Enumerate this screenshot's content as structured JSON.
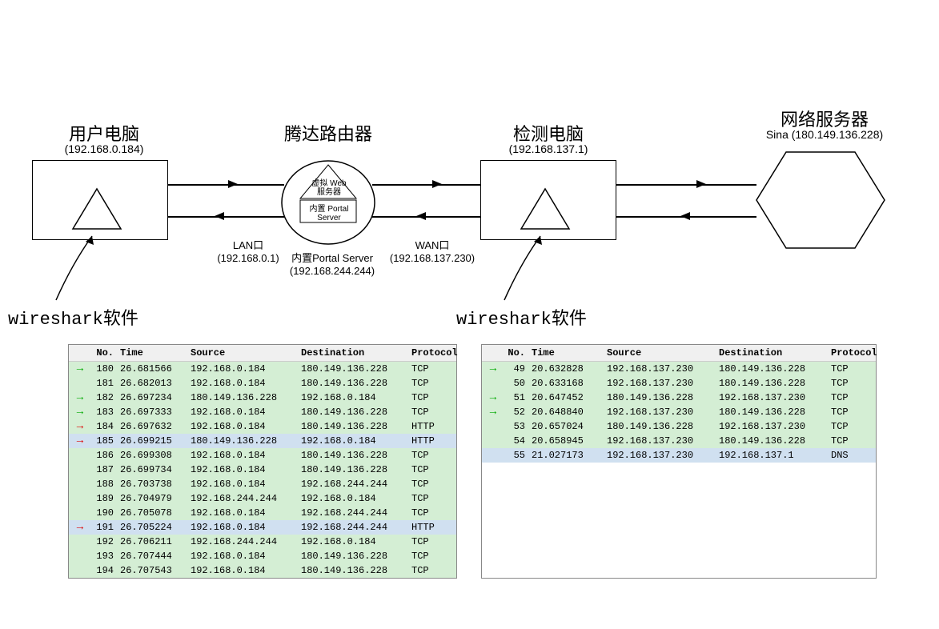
{
  "diagram": {
    "nodes": {
      "user_pc": {
        "title": "用户电脑",
        "ip": "(192.168.0.184)"
      },
      "router": {
        "title": "腾达路由器",
        "virtual_web": "虚拟\nWeb服务器",
        "portal_inner": "内置\nPortal Server",
        "lan_label": "LAN口",
        "lan_ip": "(192.168.0.1)",
        "portal_label": "内置Portal Server",
        "portal_ip": "(192.168.244.244)",
        "wan_label": "WAN口",
        "wan_ip": "(192.168.137.230)"
      },
      "detect_pc": {
        "title": "检测电脑",
        "ip": "(192.168.137.1)"
      },
      "server": {
        "title": "网络服务器",
        "sub": "Sina (180.149.136.228)"
      }
    },
    "wireshark_left": "wireshark软件",
    "wireshark_right": "wireshark软件"
  },
  "tables": {
    "headers": {
      "no": "No.",
      "time": "Time",
      "source": "Source",
      "destination": "Destination",
      "protocol": "Protocol"
    },
    "left": [
      {
        "mark": "green",
        "no": "180",
        "time": "26.681566",
        "src": "192.168.0.184",
        "dst": "180.149.136.228",
        "proto": "TCP",
        "cls": "green"
      },
      {
        "mark": "",
        "no": "181",
        "time": "26.682013",
        "src": "192.168.0.184",
        "dst": "180.149.136.228",
        "proto": "TCP",
        "cls": "green"
      },
      {
        "mark": "green",
        "no": "182",
        "time": "26.697234",
        "src": "180.149.136.228",
        "dst": "192.168.0.184",
        "proto": "TCP",
        "cls": "green"
      },
      {
        "mark": "green",
        "no": "183",
        "time": "26.697333",
        "src": "192.168.0.184",
        "dst": "180.149.136.228",
        "proto": "TCP",
        "cls": "green"
      },
      {
        "mark": "red",
        "no": "184",
        "time": "26.697632",
        "src": "192.168.0.184",
        "dst": "180.149.136.228",
        "proto": "HTTP",
        "cls": "green"
      },
      {
        "mark": "red",
        "no": "185",
        "time": "26.699215",
        "src": "180.149.136.228",
        "dst": "192.168.0.184",
        "proto": "HTTP",
        "cls": "blue"
      },
      {
        "mark": "",
        "no": "186",
        "time": "26.699308",
        "src": "192.168.0.184",
        "dst": "180.149.136.228",
        "proto": "TCP",
        "cls": "green"
      },
      {
        "mark": "",
        "no": "187",
        "time": "26.699734",
        "src": "192.168.0.184",
        "dst": "180.149.136.228",
        "proto": "TCP",
        "cls": "green"
      },
      {
        "mark": "",
        "no": "188",
        "time": "26.703738",
        "src": "192.168.0.184",
        "dst": "192.168.244.244",
        "proto": "TCP",
        "cls": "green"
      },
      {
        "mark": "",
        "no": "189",
        "time": "26.704979",
        "src": "192.168.244.244",
        "dst": "192.168.0.184",
        "proto": "TCP",
        "cls": "green"
      },
      {
        "mark": "",
        "no": "190",
        "time": "26.705078",
        "src": "192.168.0.184",
        "dst": "192.168.244.244",
        "proto": "TCP",
        "cls": "green"
      },
      {
        "mark": "red",
        "no": "191",
        "time": "26.705224",
        "src": "192.168.0.184",
        "dst": "192.168.244.244",
        "proto": "HTTP",
        "cls": "blue"
      },
      {
        "mark": "",
        "no": "192",
        "time": "26.706211",
        "src": "192.168.244.244",
        "dst": "192.168.0.184",
        "proto": "TCP",
        "cls": "green"
      },
      {
        "mark": "",
        "no": "193",
        "time": "26.707444",
        "src": "192.168.0.184",
        "dst": "180.149.136.228",
        "proto": "TCP",
        "cls": "green"
      },
      {
        "mark": "",
        "no": "194",
        "time": "26.707543",
        "src": "192.168.0.184",
        "dst": "180.149.136.228",
        "proto": "TCP",
        "cls": "green"
      }
    ],
    "right": [
      {
        "mark": "green",
        "no": "49",
        "time": "20.632828",
        "src": "192.168.137.230",
        "dst": "180.149.136.228",
        "proto": "TCP",
        "cls": "green"
      },
      {
        "mark": "",
        "no": "50",
        "time": "20.633168",
        "src": "192.168.137.230",
        "dst": "180.149.136.228",
        "proto": "TCP",
        "cls": "green"
      },
      {
        "mark": "green",
        "no": "51",
        "time": "20.647452",
        "src": "180.149.136.228",
        "dst": "192.168.137.230",
        "proto": "TCP",
        "cls": "green"
      },
      {
        "mark": "green",
        "no": "52",
        "time": "20.648840",
        "src": "192.168.137.230",
        "dst": "180.149.136.228",
        "proto": "TCP",
        "cls": "green"
      },
      {
        "mark": "",
        "no": "53",
        "time": "20.657024",
        "src": "180.149.136.228",
        "dst": "192.168.137.230",
        "proto": "TCP",
        "cls": "green"
      },
      {
        "mark": "",
        "no": "54",
        "time": "20.658945",
        "src": "192.168.137.230",
        "dst": "180.149.136.228",
        "proto": "TCP",
        "cls": "green"
      },
      {
        "mark": "",
        "no": "55",
        "time": "21.027173",
        "src": "192.168.137.230",
        "dst": "192.168.137.1",
        "proto": "DNS",
        "cls": "blue"
      }
    ]
  }
}
